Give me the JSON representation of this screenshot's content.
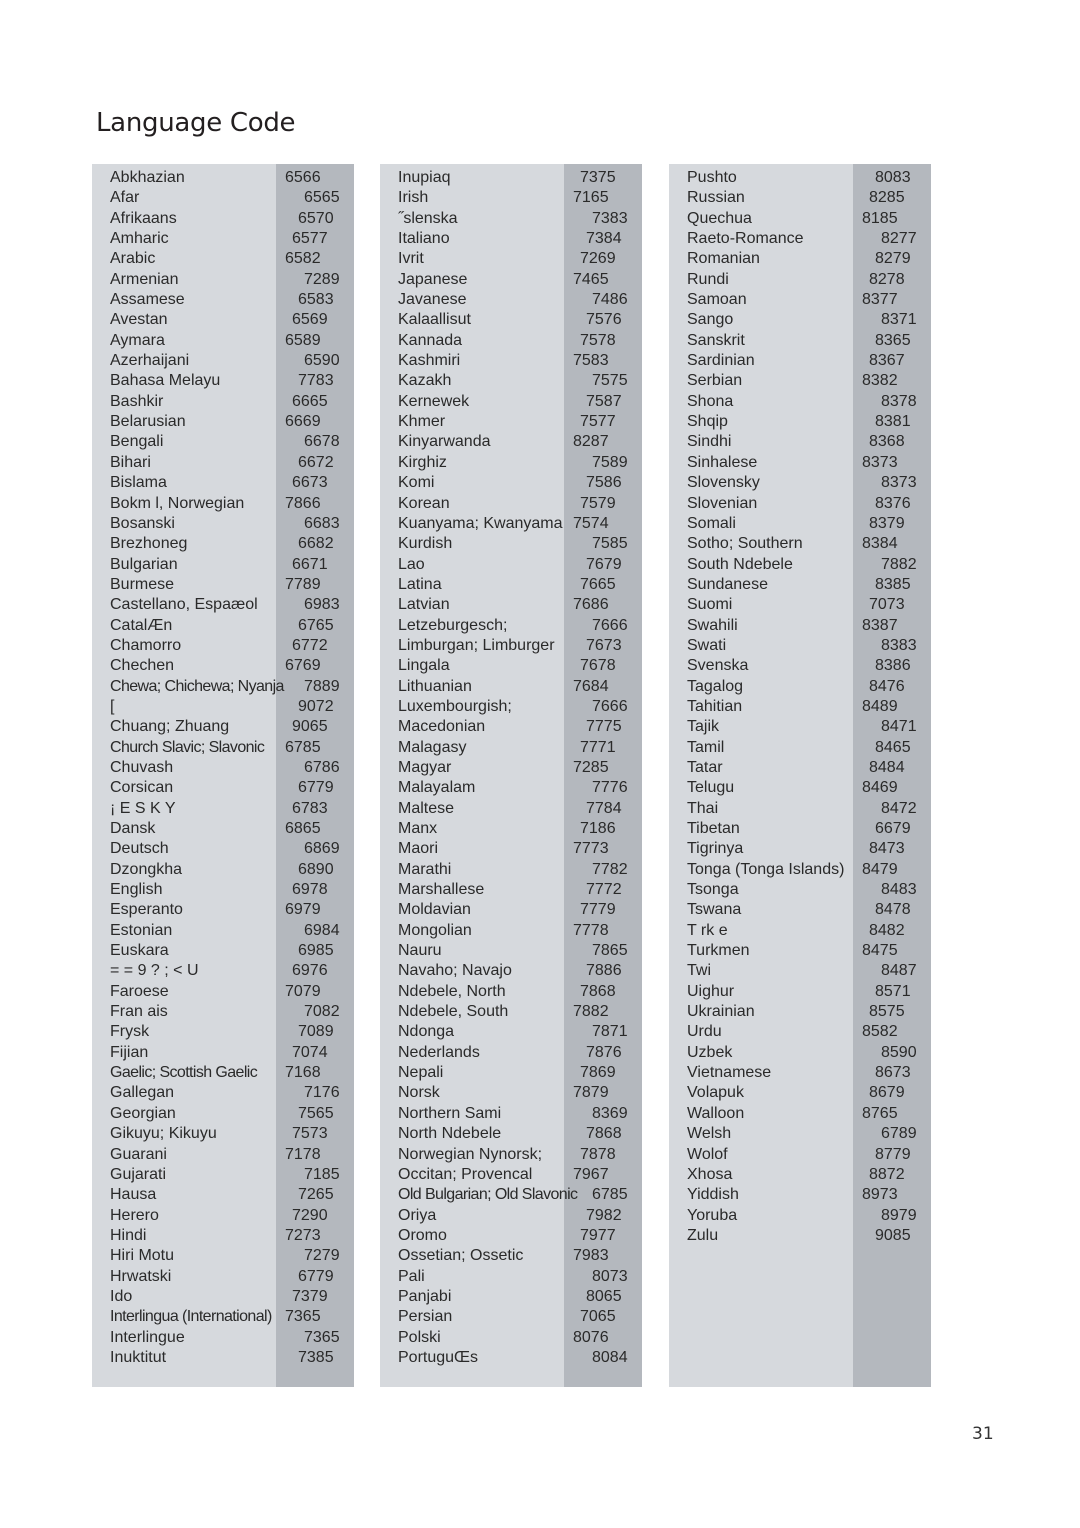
{
  "title": "Language Code",
  "page_number": "31",
  "colors": {
    "panel_light": "#d6d9dd",
    "panel_dark": "#b4b8be",
    "text": "#2a2a2a"
  },
  "columns": [
    {
      "entries": [
        {
          "name": "Abkhazian",
          "code": "6566"
        },
        {
          "name": "Afar",
          "code": "6565"
        },
        {
          "name": "Afrikaans",
          "code": "6570"
        },
        {
          "name": "Amharic",
          "code": "6577"
        },
        {
          "name": "Arabic",
          "code": "6582"
        },
        {
          "name": "Armenian",
          "code": "7289"
        },
        {
          "name": "Assamese",
          "code": "6583"
        },
        {
          "name": "Avestan",
          "code": "6569"
        },
        {
          "name": "Aymara",
          "code": "6589"
        },
        {
          "name": "Azerhaijani",
          "code": "6590"
        },
        {
          "name": "Bahasa Melayu",
          "code": "7783"
        },
        {
          "name": "Bashkir",
          "code": "6665"
        },
        {
          "name": "Belarusian",
          "code": "6669"
        },
        {
          "name": "Bengali",
          "code": "6678"
        },
        {
          "name": "Bihari",
          "code": "6672"
        },
        {
          "name": "Bislama",
          "code": "6673"
        },
        {
          "name": "Bokm l, Norwegian",
          "code": "7866"
        },
        {
          "name": "Bosanski",
          "code": "6683"
        },
        {
          "name": "Brezhoneg",
          "code": "6682"
        },
        {
          "name": "Bulgarian",
          "code": "6671"
        },
        {
          "name": "Burmese",
          "code": "7789"
        },
        {
          "name": "Castellano, Espaæol",
          "code": "6983"
        },
        {
          "name": "CatalÆn",
          "code": "6765"
        },
        {
          "name": "Chamorro",
          "code": "6772"
        },
        {
          "name": "Chechen",
          "code": "6769"
        },
        {
          "name": "Chewa; Chichewa; Nyanja",
          "code": "7889"
        },
        {
          "name": "  [",
          "code": "9072"
        },
        {
          "name": "Chuang; Zhuang",
          "code": "9065"
        },
        {
          "name": "Church Slavic; Slavonic",
          "code": "6785"
        },
        {
          "name": "Chuvash",
          "code": "6786"
        },
        {
          "name": "Corsican",
          "code": "6779"
        },
        {
          "name": " ¡ E S K Y",
          "code": "6783"
        },
        {
          "name": "Dansk",
          "code": "6865"
        },
        {
          "name": "Deutsch",
          "code": "6869"
        },
        {
          "name": "Dzongkha",
          "code": "6890"
        },
        {
          "name": "English",
          "code": "6978"
        },
        {
          "name": "Esperanto",
          "code": "6979"
        },
        {
          "name": "Estonian",
          "code": "6984"
        },
        {
          "name": "Euskara",
          "code": "6985"
        },
        {
          "name": "   = = 9 ? ; < U",
          "code": "6976"
        },
        {
          "name": "Faroese",
          "code": "7079"
        },
        {
          "name": "Fran ais",
          "code": "7082"
        },
        {
          "name": "Frysk",
          "code": "7089"
        },
        {
          "name": "Fijian",
          "code": "7074"
        },
        {
          "name": "Gaelic; Scottish Gaelic",
          "code": "7168"
        },
        {
          "name": "Gallegan",
          "code": "7176"
        },
        {
          "name": "Georgian",
          "code": "7565"
        },
        {
          "name": "Gikuyu; Kikuyu",
          "code": "7573"
        },
        {
          "name": "Guarani",
          "code": "7178"
        },
        {
          "name": "Gujarati",
          "code": "7185"
        },
        {
          "name": "Hausa",
          "code": "7265"
        },
        {
          "name": "Herero",
          "code": "7290"
        },
        {
          "name": "Hindi",
          "code": "7273"
        },
        {
          "name": "Hiri Motu",
          "code": "7279"
        },
        {
          "name": "Hrwatski",
          "code": "6779"
        },
        {
          "name": "Ido",
          "code": "7379"
        },
        {
          "name": "Interlingua (International)",
          "code": "7365"
        },
        {
          "name": "Interlingue",
          "code": "7365"
        },
        {
          "name": "Inuktitut",
          "code": "7385"
        }
      ]
    },
    {
      "entries": [
        {
          "name": "Inupiaq",
          "code": "7375"
        },
        {
          "name": "Irish",
          "code": "7165"
        },
        {
          "name": "˝slenska",
          "code": "7383"
        },
        {
          "name": "Italiano",
          "code": "7384"
        },
        {
          "name": "Ivrit",
          "code": "7269"
        },
        {
          "name": "Japanese",
          "code": "7465"
        },
        {
          "name": "Javanese",
          "code": "7486"
        },
        {
          "name": "Kalaallisut",
          "code": "7576"
        },
        {
          "name": "Kannada",
          "code": "7578"
        },
        {
          "name": "Kashmiri",
          "code": "7583"
        },
        {
          "name": "Kazakh",
          "code": "7575"
        },
        {
          "name": "Kernewek",
          "code": "7587"
        },
        {
          "name": "Khmer",
          "code": "7577"
        },
        {
          "name": "Kinyarwanda",
          "code": "8287"
        },
        {
          "name": "Kirghiz",
          "code": "7589"
        },
        {
          "name": "Komi",
          "code": "7586"
        },
        {
          "name": "Korean",
          "code": "7579"
        },
        {
          "name": "Kuanyama; Kwanyama",
          "code": "7574"
        },
        {
          "name": "Kurdish",
          "code": "7585"
        },
        {
          "name": "Lao",
          "code": "7679"
        },
        {
          "name": "Latina",
          "code": "7665"
        },
        {
          "name": "Latvian",
          "code": "7686"
        },
        {
          "name": "Letzeburgesch;",
          "code": "7666"
        },
        {
          "name": "Limburgan; Limburger",
          "code": "7673"
        },
        {
          "name": "Lingala",
          "code": "7678"
        },
        {
          "name": "Lithuanian",
          "code": "7684"
        },
        {
          "name": "Luxembourgish;",
          "code": "7666"
        },
        {
          "name": "Macedonian",
          "code": "7775"
        },
        {
          "name": "Malagasy",
          "code": "7771"
        },
        {
          "name": "Magyar",
          "code": "7285"
        },
        {
          "name": "Malayalam",
          "code": "7776"
        },
        {
          "name": "Maltese",
          "code": "7784"
        },
        {
          "name": "Manx",
          "code": "7186"
        },
        {
          "name": "Maori",
          "code": "7773"
        },
        {
          "name": "Marathi",
          "code": "7782"
        },
        {
          "name": "Marshallese",
          "code": "7772"
        },
        {
          "name": "Moldavian",
          "code": "7779"
        },
        {
          "name": "Mongolian",
          "code": "7778"
        },
        {
          "name": "Nauru",
          "code": "7865"
        },
        {
          "name": "Navaho; Navajo",
          "code": "7886"
        },
        {
          "name": "Ndebele, North",
          "code": "7868"
        },
        {
          "name": "Ndebele, South",
          "code": "7882"
        },
        {
          "name": "Ndonga",
          "code": "7871"
        },
        {
          "name": "Nederlands",
          "code": "7876"
        },
        {
          "name": "Nepali",
          "code": "7869"
        },
        {
          "name": "Norsk",
          "code": "7879"
        },
        {
          "name": "Northern Sami",
          "code": "8369"
        },
        {
          "name": "North Ndebele",
          "code": "7868"
        },
        {
          "name": "Norwegian Nynorsk;",
          "code": "7878"
        },
        {
          "name": "Occitan; Provencal",
          "code": "7967"
        },
        {
          "name": "Old Bulgarian; Old Slavonic",
          "code": "6785"
        },
        {
          "name": "Oriya",
          "code": "7982"
        },
        {
          "name": "Oromo",
          "code": "7977"
        },
        {
          "name": "Ossetian; Ossetic",
          "code": "7983"
        },
        {
          "name": "Pali",
          "code": "8073"
        },
        {
          "name": "Panjabi",
          "code": "8065"
        },
        {
          "name": "Persian",
          "code": "7065"
        },
        {
          "name": "Polski",
          "code": "8076"
        },
        {
          "name": "PortuguŒs",
          "code": "8084"
        }
      ]
    },
    {
      "entries": [
        {
          "name": "Pushto",
          "code": "8083"
        },
        {
          "name": "Russian",
          "code": "8285"
        },
        {
          "name": "Quechua",
          "code": "8185"
        },
        {
          "name": "Raeto-Romance",
          "code": "8277"
        },
        {
          "name": "Romanian",
          "code": "8279"
        },
        {
          "name": "Rundi",
          "code": "8278"
        },
        {
          "name": "Samoan",
          "code": "8377"
        },
        {
          "name": "Sango",
          "code": "8371"
        },
        {
          "name": "Sanskrit",
          "code": "8365"
        },
        {
          "name": "Sardinian",
          "code": "8367"
        },
        {
          "name": "Serbian",
          "code": "8382"
        },
        {
          "name": "Shona",
          "code": "8378"
        },
        {
          "name": "Shqip",
          "code": "8381"
        },
        {
          "name": "Sindhi",
          "code": "8368"
        },
        {
          "name": "Sinhalese",
          "code": "8373"
        },
        {
          "name": "Slovensky",
          "code": "8373"
        },
        {
          "name": "Slovenian",
          "code": "8376"
        },
        {
          "name": "Somali",
          "code": "8379"
        },
        {
          "name": "Sotho; Southern",
          "code": "8384"
        },
        {
          "name": "South Ndebele",
          "code": "7882"
        },
        {
          "name": "Sundanese",
          "code": "8385"
        },
        {
          "name": "Suomi",
          "code": "7073"
        },
        {
          "name": "Swahili",
          "code": "8387"
        },
        {
          "name": "Swati",
          "code": "8383"
        },
        {
          "name": "Svenska",
          "code": "8386"
        },
        {
          "name": "Tagalog",
          "code": "8476"
        },
        {
          "name": "Tahitian",
          "code": "8489"
        },
        {
          "name": "Tajik",
          "code": "8471"
        },
        {
          "name": "Tamil",
          "code": "8465"
        },
        {
          "name": "Tatar",
          "code": "8484"
        },
        {
          "name": "Telugu",
          "code": "8469"
        },
        {
          "name": "Thai",
          "code": "8472"
        },
        {
          "name": "Tibetan",
          "code": "6679"
        },
        {
          "name": "Tigrinya",
          "code": "8473"
        },
        {
          "name": "Tonga (Tonga Islands)",
          "code": "8479"
        },
        {
          "name": "Tsonga",
          "code": "8483"
        },
        {
          "name": "Tswana",
          "code": "8478"
        },
        {
          "name": "T rk e",
          "code": "8482"
        },
        {
          "name": "Turkmen",
          "code": "8475"
        },
        {
          "name": "Twi",
          "code": "8487"
        },
        {
          "name": "Uighur",
          "code": "8571"
        },
        {
          "name": "Ukrainian",
          "code": "8575"
        },
        {
          "name": "Urdu",
          "code": "8582"
        },
        {
          "name": "Uzbek",
          "code": "8590"
        },
        {
          "name": "Vietnamese",
          "code": "8673"
        },
        {
          "name": "Volapuk",
          "code": "8679"
        },
        {
          "name": "Walloon",
          "code": "8765"
        },
        {
          "name": "Welsh",
          "code": "6789"
        },
        {
          "name": "Wolof",
          "code": "8779"
        },
        {
          "name": "Xhosa",
          "code": "8872"
        },
        {
          "name": "Yiddish",
          "code": "8973"
        },
        {
          "name": "Yoruba",
          "code": "8979"
        },
        {
          "name": "Zulu",
          "code": "9085"
        }
      ]
    }
  ]
}
